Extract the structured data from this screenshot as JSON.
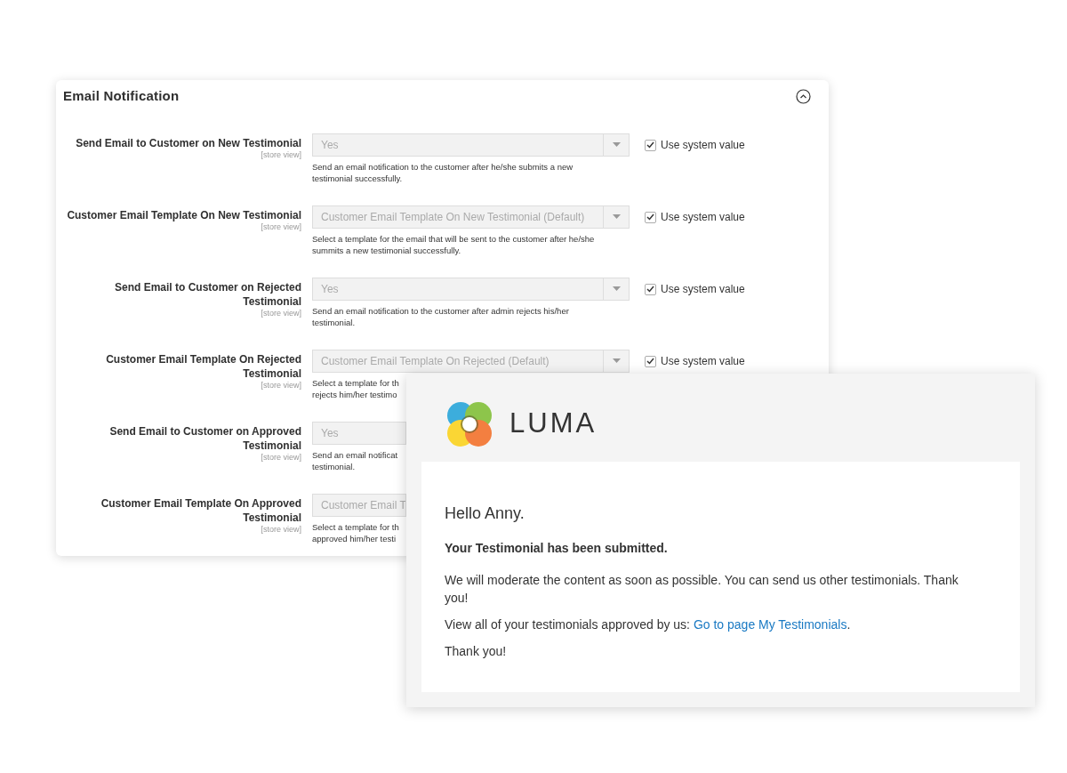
{
  "settings_panel": {
    "title": "Email Notification",
    "expanded": true,
    "rows": [
      {
        "label": "Send Email to Customer on New Testimonial",
        "scope": "[store view]",
        "value": "Yes",
        "help": [
          "Send an email notification to the customer after he/she submits a new",
          "testimonial successfully."
        ],
        "use_system_value": {
          "label": "Use system value",
          "checked": true
        }
      },
      {
        "label": "Customer Email Template On New Testimonial",
        "scope": "[store view]",
        "value": "Customer Email Template On New Testimonial (Default)",
        "help": [
          "Select a template for the email that will be sent to the customer after he/she",
          "summits a new testimonial successfully."
        ],
        "use_system_value": {
          "label": "Use system value",
          "checked": true
        }
      },
      {
        "label": "Send Email to Customer on Rejected Testimonial",
        "scope": "[store view]",
        "value": "Yes",
        "help": [
          "Send an email notification to the customer after admin rejects his/her",
          "testimonial."
        ],
        "use_system_value": {
          "label": "Use system value",
          "checked": true
        }
      },
      {
        "label": "Customer Email Template On Rejected Testimonial",
        "scope": "[store view]",
        "value": "Customer Email Template On Rejected (Default)",
        "help": [
          "Select a template for th",
          "rejects him/her testimo"
        ],
        "use_system_value": {
          "label": "Use system value",
          "checked": true
        }
      },
      {
        "kind": "cut_off",
        "label": "Send Email to Customer on Approved Testimonial",
        "scope": "[store view]",
        "value": "Yes",
        "help": [
          "Send an email notificat",
          "testimonial."
        ]
      },
      {
        "kind": "cut_off",
        "label": "Customer Email Template On Approved Testimonial",
        "scope": "[store view]",
        "value": "Customer Email T",
        "help": [
          "Select a template for th",
          "approved him/her testi"
        ]
      }
    ]
  },
  "email": {
    "brand": "LUMA",
    "greeting": "Hello Anny.",
    "heading": "Your Testimonial has been submitted.",
    "paragraphs": [
      {
        "text": "We will moderate the content as soon as possible. You can send us other testimonials. Thank you!"
      },
      {
        "text": "View all of your testimonials approved by us: ",
        "link": "Go to page My Testimonials",
        "after": "."
      },
      {
        "text": "Thank you!"
      }
    ]
  }
}
